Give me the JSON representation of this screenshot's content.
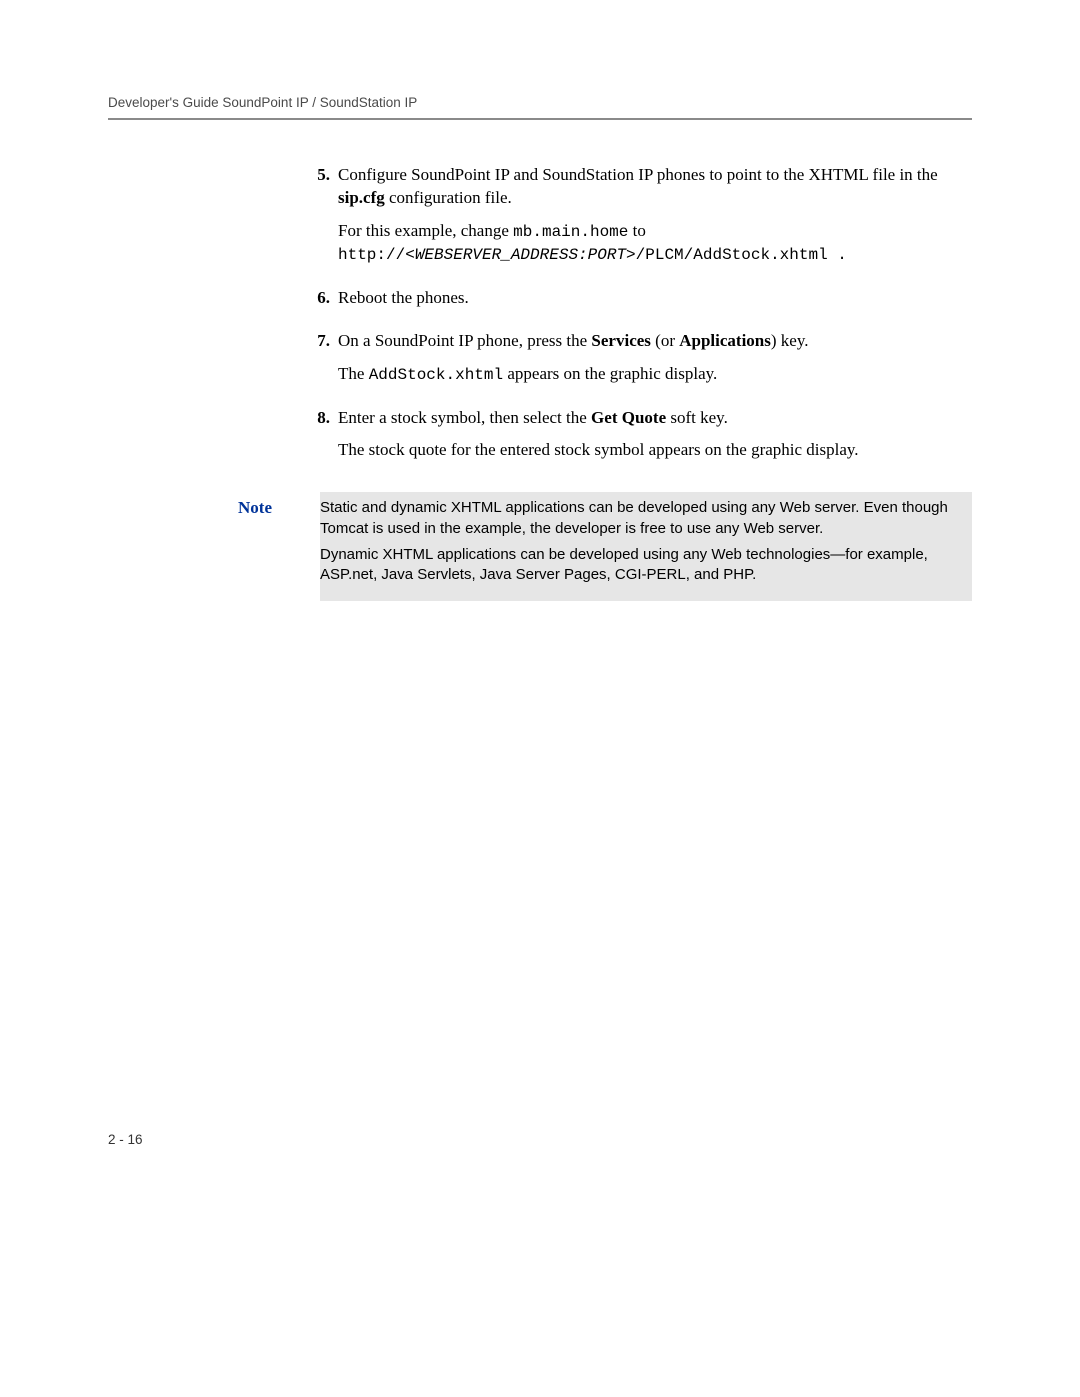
{
  "header": "Developer's Guide SoundPoint IP / SoundStation IP",
  "items": {
    "n5": {
      "num": "5.",
      "p1a": "Configure SoundPoint IP and SoundStation IP phones to point to the XHTML file in the ",
      "p1b": "sip.cfg",
      "p1c": " configuration file.",
      "p2a": "For this example, change ",
      "p2b": "mb.main.home",
      "p2c": " to",
      "p3a": "http://<",
      "p3b": "WEBSERVER_ADDRESS:PORT",
      "p3c": ">/PLCM/AddStock.xhtml ."
    },
    "n6": {
      "num": "6.",
      "p1": "Reboot the phones."
    },
    "n7": {
      "num": "7.",
      "p1a": "On a SoundPoint IP phone, press the ",
      "p1b": "Services",
      "p1c": " (or ",
      "p1d": "Applications",
      "p1e": ") key.",
      "p2a": "The ",
      "p2b": "AddStock.xhtml",
      "p2c": " appears on the graphic display."
    },
    "n8": {
      "num": "8.",
      "p1a": "Enter a stock symbol, then select the ",
      "p1b": "Get Quote",
      "p1c": " soft key.",
      "p2": "The stock quote for the entered stock symbol appears on the graphic display."
    }
  },
  "note": {
    "label": "Note",
    "p1": "Static and dynamic XHTML applications can be developed using any Web server. Even though Tomcat is used in the example, the developer is free to use any Web server.",
    "p2": "Dynamic XHTML applications can be developed using any Web technologies—for example, ASP.net, Java Servlets, Java Server Pages, CGI-PERL, and PHP."
  },
  "pageNumber": "2 - 16"
}
